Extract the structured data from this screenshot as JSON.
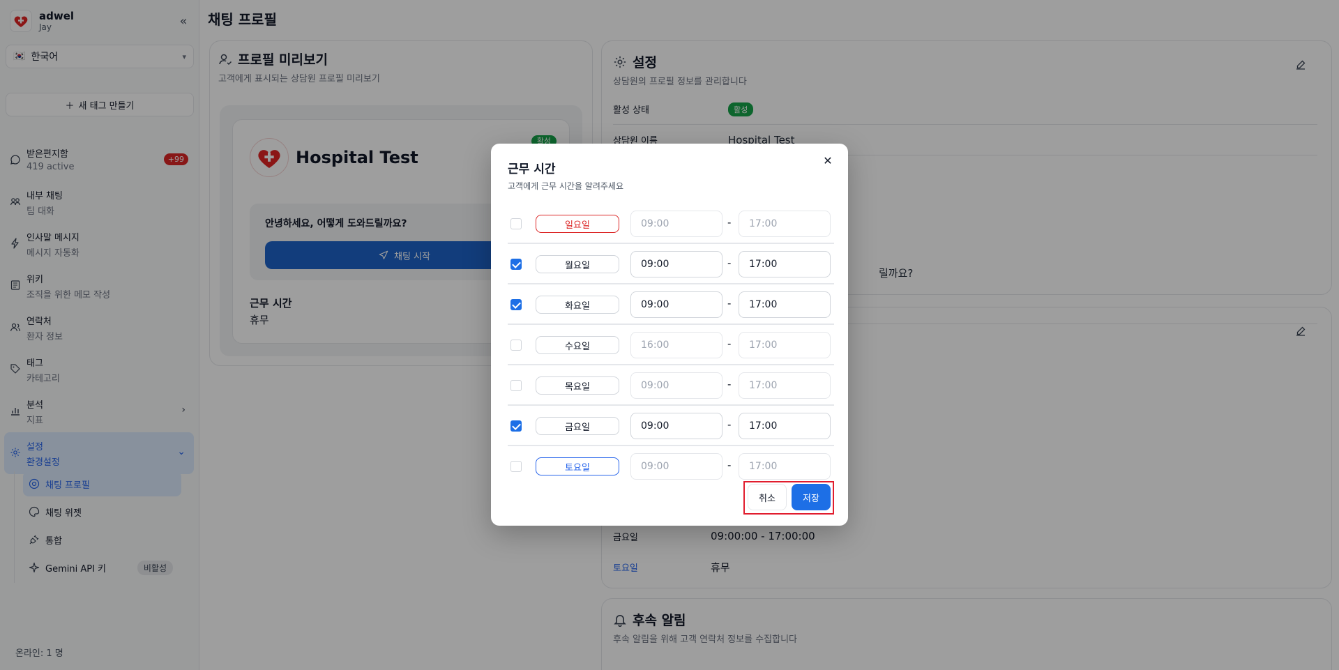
{
  "brand": {
    "name": "adwel",
    "user": "Jay"
  },
  "language": {
    "flag": "🇰🇷",
    "value": "한국어"
  },
  "new_tag_label": "새 태그 만들기",
  "nav": [
    {
      "title": "받은편지함",
      "sub": "419 active",
      "badge": "+99",
      "icon": "chat-bubble-icon"
    },
    {
      "title": "내부 채팅",
      "sub": "팀 대화",
      "icon": "team-icon"
    },
    {
      "title": "인사말 메시지",
      "sub": "메시지 자동화",
      "icon": "lightning-icon"
    },
    {
      "title": "위키",
      "sub": "조직을 위한 메모 작성",
      "icon": "book-icon"
    },
    {
      "title": "연락처",
      "sub": "환자 정보",
      "icon": "contacts-icon"
    },
    {
      "title": "태그",
      "sub": "카테고리",
      "icon": "tag-icon"
    },
    {
      "title": "분석",
      "sub": "지표",
      "icon": "bar-chart-icon"
    },
    {
      "title": "설정",
      "sub": "환경설정",
      "icon": "gear-icon"
    }
  ],
  "subnav": [
    {
      "label": "채팅 프로필",
      "icon": "profile-circle-icon"
    },
    {
      "label": "채팅 위젯",
      "icon": "palette-icon"
    },
    {
      "label": "통합",
      "icon": "plug-icon"
    },
    {
      "label": "Gemini API 키",
      "badge": "비활성",
      "icon": "sparkle-icon"
    }
  ],
  "online": "온라인:  1 명",
  "page_title": "채팅 프로필",
  "preview": {
    "title": "프로필 미리보기",
    "subtitle": "고객에게 표시되는 상담원 프로필 미리보기",
    "name": "Hospital Test",
    "active_badge": "활성",
    "greeting": "안녕하세요, 어떻게 도와드릴까요?",
    "chat_button": "채팅 시작",
    "hours_label": "근무 시간",
    "hours_value": "휴무"
  },
  "settings": {
    "title": "설정",
    "subtitle": "상담원의 프로필 정보를 관리합니다",
    "status_label": "활성 상태",
    "status_value": "활성",
    "name_label": "상담원 이름",
    "name_value": "Hospital Test",
    "greeting_value_tail": "릴까요?"
  },
  "hours_card": {
    "rows": [
      {
        "day": "금요일",
        "value": "09:00:00 - 17:00:00"
      },
      {
        "day": "토요일",
        "value": "휴무"
      }
    ]
  },
  "followup": {
    "title": "후속 알림",
    "subtitle": "후속 알림을 위해 고객 연락처 정보를 수집합니다"
  },
  "modal": {
    "title": "근무 시간",
    "subtitle": "고객에게 근무 시간을 알려주세요",
    "days": [
      {
        "label": "일요일",
        "checked": false,
        "start": "09:00",
        "end": "17:00",
        "style": "sun"
      },
      {
        "label": "월요일",
        "checked": true,
        "start": "09:00",
        "end": "17:00",
        "style": ""
      },
      {
        "label": "화요일",
        "checked": true,
        "start": "09:00",
        "end": "17:00",
        "style": ""
      },
      {
        "label": "수요일",
        "checked": false,
        "start": "16:00",
        "end": "17:00",
        "style": ""
      },
      {
        "label": "목요일",
        "checked": false,
        "start": "09:00",
        "end": "17:00",
        "style": ""
      },
      {
        "label": "금요일",
        "checked": true,
        "start": "09:00",
        "end": "17:00",
        "style": ""
      },
      {
        "label": "토요일",
        "checked": false,
        "start": "09:00",
        "end": "17:00",
        "style": "sat"
      }
    ],
    "cancel": "취소",
    "save": "저장"
  },
  "colors": {
    "primary": "#1d6fe6",
    "danger": "#dc2626",
    "success": "#16a34a",
    "highlight_frame": "#e11d2e"
  }
}
